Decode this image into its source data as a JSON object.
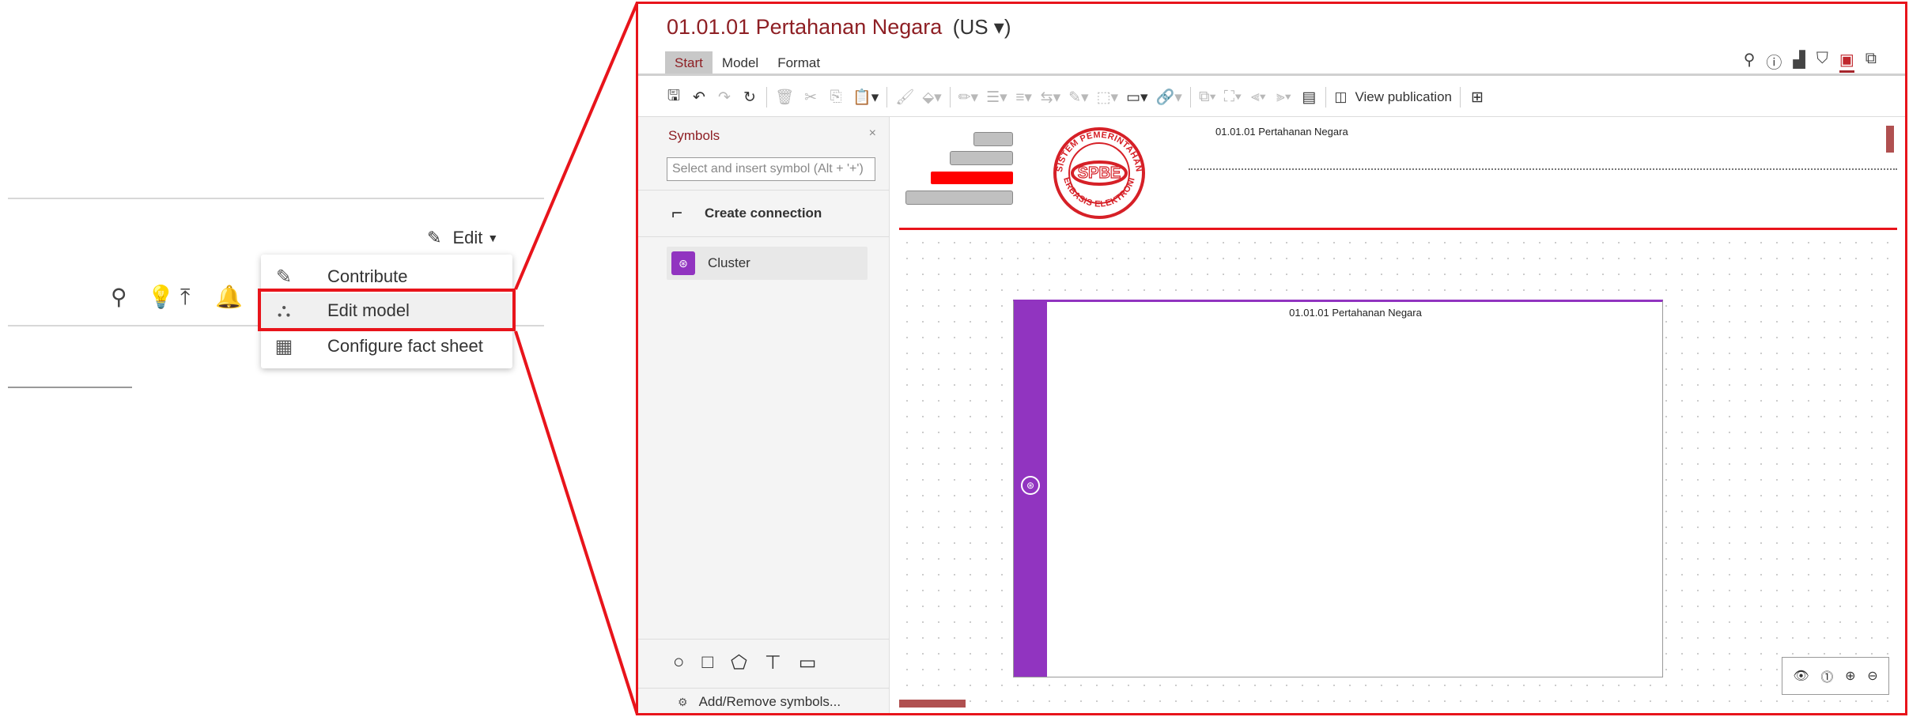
{
  "left": {
    "edit_label": "Edit",
    "menu": [
      {
        "label": "Contribute",
        "icon": "pencil-icon"
      },
      {
        "label": "Edit model",
        "icon": "edit-model-icon"
      },
      {
        "label": "Configure fact sheet",
        "icon": "grid-icon"
      }
    ],
    "icons": [
      "search-icon",
      "lightbulb-icon",
      "upload-icon",
      "bell-icon"
    ]
  },
  "app": {
    "title": "01.01.01 Pertahanan Negara",
    "language": "(US",
    "tabs": [
      "Start",
      "Model",
      "Format"
    ],
    "active_tab": "Start",
    "view_publication": "View publication",
    "sidebar": {
      "title": "Symbols",
      "close": "×",
      "search_placeholder": "Select and insert symbol (Alt + '+')",
      "create_connection": "Create connection",
      "cluster": "Cluster",
      "add_remove": "Add/Remove symbols..."
    },
    "canvas": {
      "header_title": "01.01.01 Pertahanan Negara",
      "cluster_title": "01.01.01 Pertahanan Negara",
      "logo_top_text": "SISTEM PEMERINTAHAN",
      "logo_center_text": "SPBE",
      "logo_bottom_text": "BERBASIS ELEKTRONIK"
    }
  },
  "colors": {
    "accent": "#8e1f24",
    "highlight": "#e8141b",
    "cluster": "#9134c0"
  }
}
